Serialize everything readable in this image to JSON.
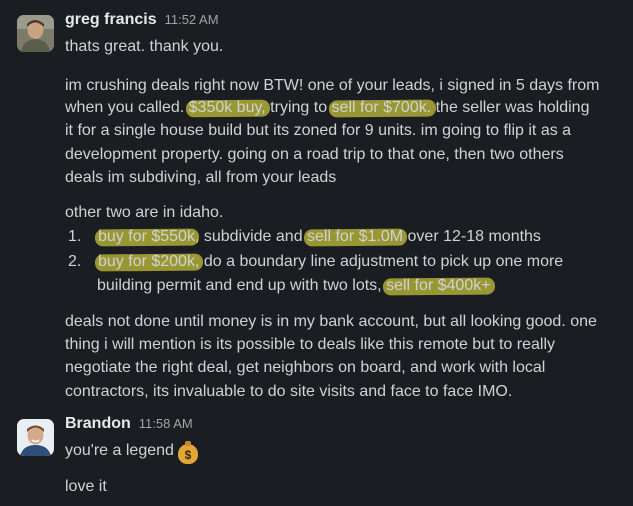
{
  "messages": [
    {
      "sender": "greg francis",
      "time": "11:52 AM",
      "avatar": "greg-francis-avatar",
      "line1": "thats great. thank you.",
      "p1": {
        "l1": "im crushing deals right now BTW! one of your leads, i signed in 5 days from",
        "l2a": "when you called. ",
        "l2b": "$350k buy,",
        "l2c": " trying to ",
        "l2d": "sell for $700k.",
        "l2e": " the seller was holding",
        "l3": "it for a single house build but its zoned for 9 units. im going to flip it as a",
        "l4": "development property. going on a road trip to that one, then two others",
        "l5": "deals im subdiving, all from your leads"
      },
      "p2": {
        "intro": "other two are in idaho.",
        "item1": {
          "num": "1.",
          "a": "buy for $550k",
          "b": ", subdivide and ",
          "c": "sell for $1.0M",
          "d": " over 12-18 months"
        },
        "item2": {
          "num": "2.",
          "a": "buy for $200k,",
          "b": " do a boundary line adjustment to pick up one more",
          "c": "building permit and end up with two lots, ",
          "d": "sell for $400k+"
        }
      },
      "p3": {
        "l1": "deals not done until money is in my bank account, but all looking good. one",
        "l2": "thing i will mention is its possible to deals like this remote but to really",
        "l3": "negotiate the right deal, get neighbors on board, and work with local",
        "l4": "contractors, its invaluable to do site visits and face to face  IMO."
      }
    },
    {
      "sender": "Brandon",
      "time": "11:58 AM",
      "avatar": "brandon-avatar",
      "line1": "you're a legend",
      "emoji": "money-bag-icon",
      "line2": "love it"
    }
  ],
  "colors": {
    "background": "#1a1d21",
    "text": "#d1d2d3",
    "highlight": "#c9c63a"
  }
}
